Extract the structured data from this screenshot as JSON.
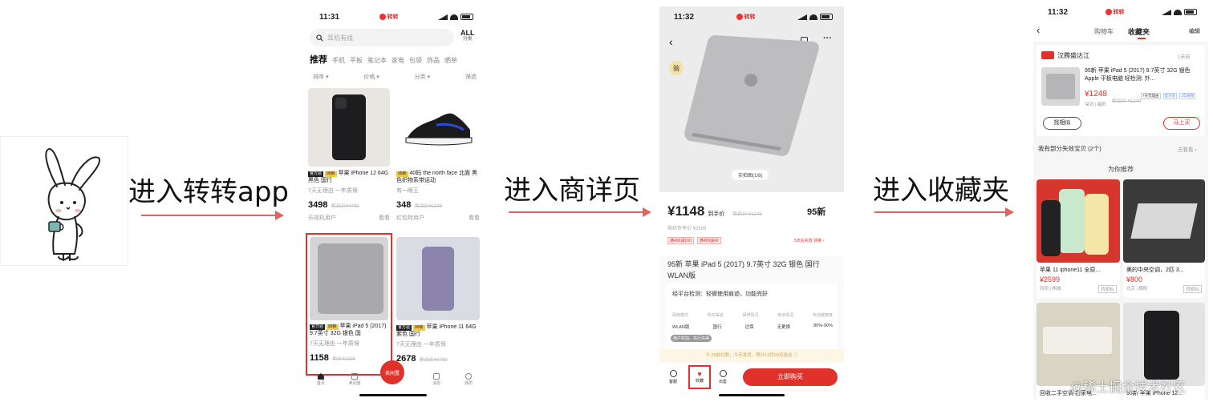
{
  "captions": {
    "step1": "进入转转app",
    "step2": "进入商详页",
    "step3": "进入收藏夹"
  },
  "colors": {
    "arrow": "#e0635f",
    "brand": "#e0322b",
    "highlight": "#e0322b"
  },
  "screen1": {
    "time": "11:31",
    "brand": "转转",
    "search_placeholder": "耳机有线",
    "all_label": "ALL",
    "all_sub": "分类",
    "tabs": [
      "推荐",
      "手机",
      "平板",
      "笔记本",
      "家电",
      "包袋",
      "饰品",
      "晒单"
    ],
    "filters": [
      "排序 ▾",
      "价格 ▾",
      "分类 ▾",
      "筛选"
    ],
    "products": [
      {
        "official": "官方验",
        "cond": "95新",
        "title": "苹果 iPhone 12 64G 黑色 国行",
        "meta1": "7天无理由",
        "meta2": "一年质保",
        "price": "3498",
        "old": "新品价¥4499",
        "seller": "乐视机用户",
        "action": "看看"
      },
      {
        "cond": "95新",
        "title": "40码 the north face 北面 黑色织物系带运动",
        "meta1": "有一眼王",
        "meta2": "",
        "price": "348",
        "old": "新品价¥1198",
        "seller": "红包转用户",
        "action": "看看"
      },
      {
        "official": "官方验",
        "cond": "95新",
        "title": "苹果 iPad 5 (2017) 9.7英寸 32G 银色 国",
        "meta1": "7天无理由",
        "meta2": "一年质保",
        "price": "1158",
        "old": "新价¥1395",
        "seller": "",
        "action": ""
      },
      {
        "official": "官方验",
        "cond": "95新",
        "title": "苹果 iPhone 11 64G 紫色 国行",
        "meta1": "7天无理由",
        "meta2": "一年质保",
        "price": "2678",
        "old": "新品价¥3799",
        "seller": "",
        "action": ""
      }
    ],
    "nav": [
      "首页",
      "卖闲置",
      "消息",
      "我的"
    ],
    "fab": "卖闲置"
  },
  "screen2": {
    "time": "11:32",
    "brand": "转转",
    "photo_counter": "实拍图(1/8)",
    "verified_badge": "验",
    "price": "¥1148",
    "price_suffix": "到手价",
    "old_price": "新品价 ¥1249",
    "condition": "95新",
    "ref_price": "购机参考价 ¥2699",
    "coupons": [
      "满499减100",
      "满499减40"
    ],
    "coupon_more": "5天后失效 领券 ›",
    "title": "95新 苹果 iPad 5 (2017) 9.7英寸 32G 银色 国行 WLAN版",
    "inspection": "经平台检测：轻微使用痕迹，功能完好",
    "spec_headers": [
      "网络模式",
      "购买渠道",
      "保修情况",
      "电池情况",
      "电池健康度"
    ],
    "spec_values": [
      "WLAN版",
      "国行",
      "过保",
      "无更换",
      "80%-90%"
    ],
    "spec_tag": "用户实拍，先行先得",
    "notice": "今 20前付款，今天发货，预计12月09日送达 ⓘ",
    "bottom": {
      "service": "客服",
      "favorite": "收藏",
      "sell": "出售",
      "buy": "立即购买"
    }
  },
  "screen3": {
    "time": "11:32",
    "brand": "转转",
    "tabs": [
      "购物车",
      "收藏夹"
    ],
    "edit": "编辑",
    "shop": "汉腾盛达江",
    "days_ago": "1天前",
    "item_title": "95新 苹果 iPad 5 (2017) 9.7英寸 32G 银色 Apple 平板电脑 轻检测: 外...",
    "item_price": "¥1248",
    "item_old": "新品价 ¥1249",
    "item_location": "深圳 | 福田",
    "item_tags": [
      "7天无理由",
      "官方验",
      "1年质保"
    ],
    "btn_similar": "找相似",
    "btn_buy": "马上买",
    "expired": "我有部分失效宝贝 (2个)",
    "expired_link": "去看看 ›",
    "recommend": "为你推荐",
    "recs": [
      {
        "title": "苹果 11 iphone11 全原...",
        "price": "¥2599",
        "loc": "同阳 | 桐城",
        "btn": "找相似"
      },
      {
        "title": "美的中央空调，2匹 3...",
        "price": "¥800",
        "loc": "北京 | 朝阳",
        "btn": "找相似"
      },
      {
        "title": "回收二手空调 旧家电...",
        "price": "",
        "loc": "",
        "btn": ""
      },
      {
        "title": "95新 苹果 iPhone 12...",
        "price": "",
        "loc": "",
        "btn": ""
      }
    ],
    "watermark": "@稀土掘金技术社区"
  }
}
